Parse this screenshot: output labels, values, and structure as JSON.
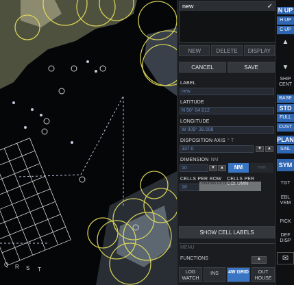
{
  "list": {
    "items": [
      "new"
    ],
    "selected_check": "✓"
  },
  "actions": {
    "new": "NEW",
    "delete": "DELETE",
    "display": "DISPLAY",
    "cancel": "CANCEL",
    "save": "SAVE"
  },
  "form": {
    "label": {
      "title": "LABEL",
      "value": "new"
    },
    "latitude": {
      "title": "LATITUDE",
      "value": "N 50° 04.012"
    },
    "longitude": {
      "title": "LONGITUDE",
      "value": "W 009° 38.508"
    },
    "disposition": {
      "title": "DISPOSITION AXIS",
      "unit": "° T",
      "value": "337.0"
    },
    "dimension": {
      "title": "DIMENSION",
      "unit": "NM",
      "value": "10",
      "unit_nm": "NM",
      "unit_mm": "mm"
    },
    "cells_per_row": {
      "title": "CELLS PER ROW",
      "value": "18"
    },
    "cells_per_column": {
      "title": "CELLS PER COLUMN",
      "tooltip": "columns for north-up..."
    }
  },
  "show_cell_labels": "SHOW CELL LABELS",
  "menu": "MENU",
  "functions": {
    "title": "FUNCTIONS",
    "buttons": [
      "LOG WATCH",
      "INS",
      "4W GRID",
      "OUT HOUSE"
    ]
  },
  "rail": {
    "n_up": "N UP",
    "h_up": "H UP",
    "c_up": "C UP",
    "ship_cent": "SHIP CENT",
    "base": "BASE",
    "std": "STD",
    "full": "FULL",
    "cust": "CUST",
    "plan": "PLAN",
    "sail": "SAIL",
    "sym": "SYM",
    "tgt": "TGT",
    "ebl_vrm": "EBL VRM",
    "pick": "PICK",
    "def_disp": "DEF DISP"
  },
  "map": {
    "grid_letters": [
      "Q",
      "R",
      "S",
      "T"
    ]
  },
  "colors": {
    "accent": "#3a75c4",
    "land": "#8a8f6b",
    "range_ring": "#e6e05a",
    "grid": "#d8d8d8"
  }
}
